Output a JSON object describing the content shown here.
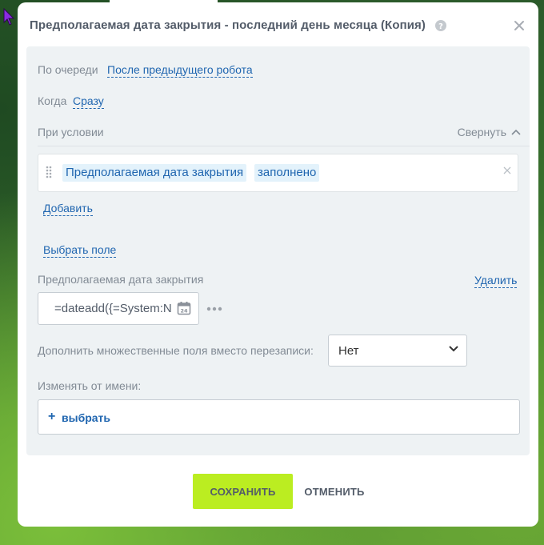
{
  "modal": {
    "title": "Предполагаемая дата закрытия - последний день месяца (Копия)"
  },
  "panel": {
    "queue_label": "По очереди",
    "queue_value": "После предыдущего робота",
    "when_label": "Когда",
    "when_value": "Сразу",
    "condition_label": "При условии",
    "collapse_label": "Свернуть",
    "condition": {
      "field": "Предполагаемая дата закрытия",
      "operator": "заполнено"
    },
    "add_label": "Добавить",
    "choose_field_label": "Выбрать поле",
    "field_label": "Предполагаемая дата закрытия",
    "delete_label": "Удалить",
    "field_value": "=dateadd({=System:N",
    "append_label": "Дополнить множественные поля вместо перезаписи:",
    "append_value": "Нет",
    "modified_by_label": "Изменять от имени:",
    "choose_user_plus": "+",
    "choose_user_label": "выбрать"
  },
  "footer": {
    "save_label": "Сохранить",
    "cancel_label": "Отменить"
  },
  "colors": {
    "accent": "#2066b0",
    "save_button": "#bbed21",
    "panel_bg": "#eef2f4",
    "label": "#828b95"
  }
}
